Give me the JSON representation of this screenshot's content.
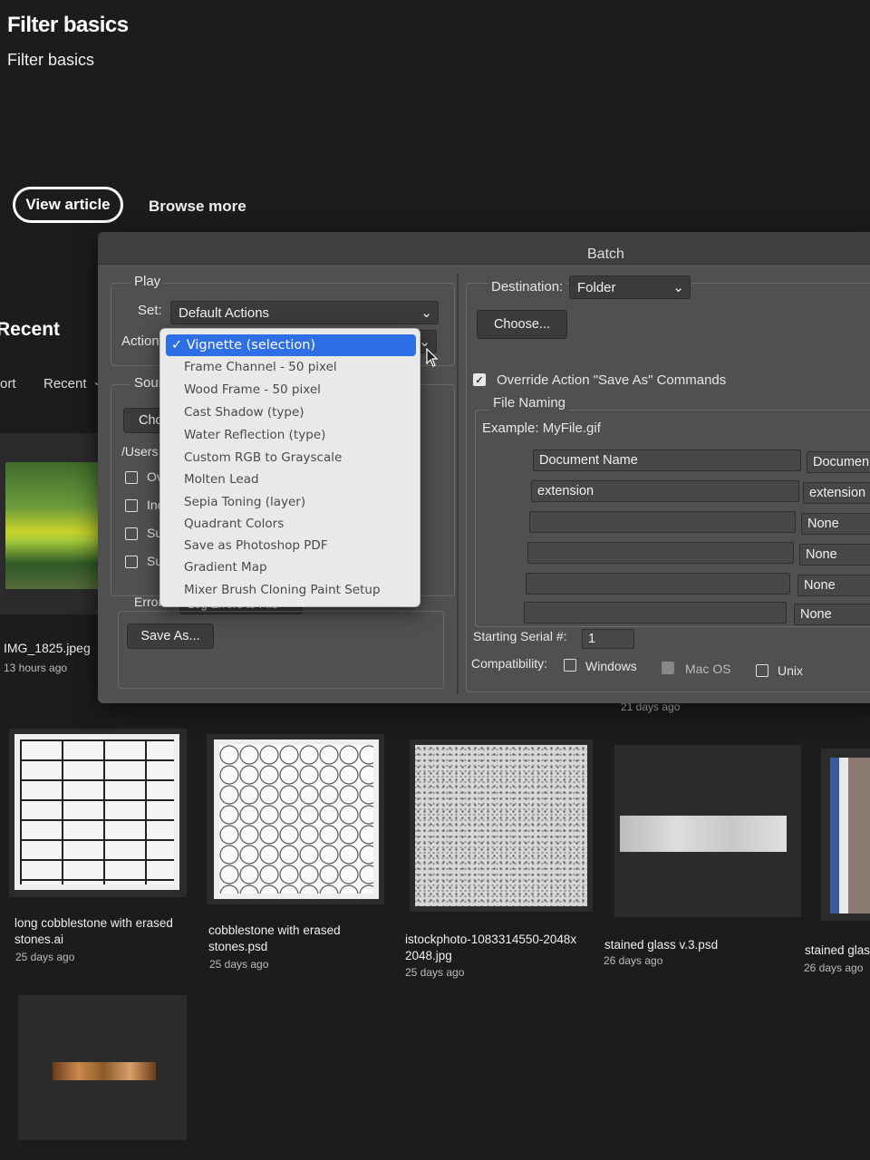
{
  "home": {
    "title": "Filter basics",
    "subtitle": "Filter basics",
    "view_article": "View article",
    "browse_more": "Browse more",
    "recent_heading": "Recent",
    "sort_label": "ort",
    "sort_value": "Recent",
    "sort_chevron": "⌄"
  },
  "files": [
    {
      "name": "IMG_1825.jpeg",
      "date": "13 hours ago"
    },
    {
      "name": "long cobblestone with erased stones.ai",
      "date": "25 days ago"
    },
    {
      "name": "cobblestone with erased stones.psd",
      "date": "25 days ago"
    },
    {
      "name": "istockphoto-1083314550-2048x 2048.jpg",
      "date": "25 days ago"
    },
    {
      "name": "stained glass v.3.psd",
      "date": "26 days ago"
    },
    {
      "name": "stained glas",
      "date": "26 days ago"
    },
    {
      "name": "",
      "date": "21 days ago"
    }
  ],
  "dialog": {
    "title": "Batch",
    "play_label": "Play",
    "set_label": "Set:",
    "set_value": "Default Actions",
    "action_label": "Action",
    "source_label": "Sour",
    "choose_partial": "Cho",
    "path_partial": "/Users",
    "checks_partial": [
      "Ov",
      "Inc",
      "Su",
      "Su"
    ],
    "errors_label": "Errors:",
    "errors_value": "Log Errors to File",
    "save_as": "Save As...",
    "destination_label": "Destination:",
    "destination_value": "Folder",
    "choose": "Choose...",
    "override_label": "Override Action \"Save As\" Commands",
    "file_naming": "File Naming",
    "example": "Example: MyFile.gif",
    "naming_fields": [
      "Document Name",
      "extension",
      "",
      "",
      "",
      ""
    ],
    "naming_selects": [
      "Documen",
      "extension",
      "None",
      "None",
      "None",
      "None"
    ],
    "serial_label": "Starting Serial #:",
    "serial_value": "1",
    "compat_label": "Compatibility:",
    "compat_windows": "Windows",
    "compat_macos": "Mac OS",
    "compat_unix": "Unix"
  },
  "menu": {
    "selected": "✓ Vignette (selection)",
    "items": [
      "Frame Channel - 50 pixel",
      "Wood Frame - 50 pixel",
      "Cast Shadow (type)",
      "Water Reflection (type)",
      "Custom RGB to Grayscale",
      "Molten Lead",
      "Sepia Toning (layer)",
      "Quadrant Colors",
      "Save as Photoshop PDF",
      "Gradient Map",
      "Mixer Brush Cloning Paint Setup"
    ]
  }
}
